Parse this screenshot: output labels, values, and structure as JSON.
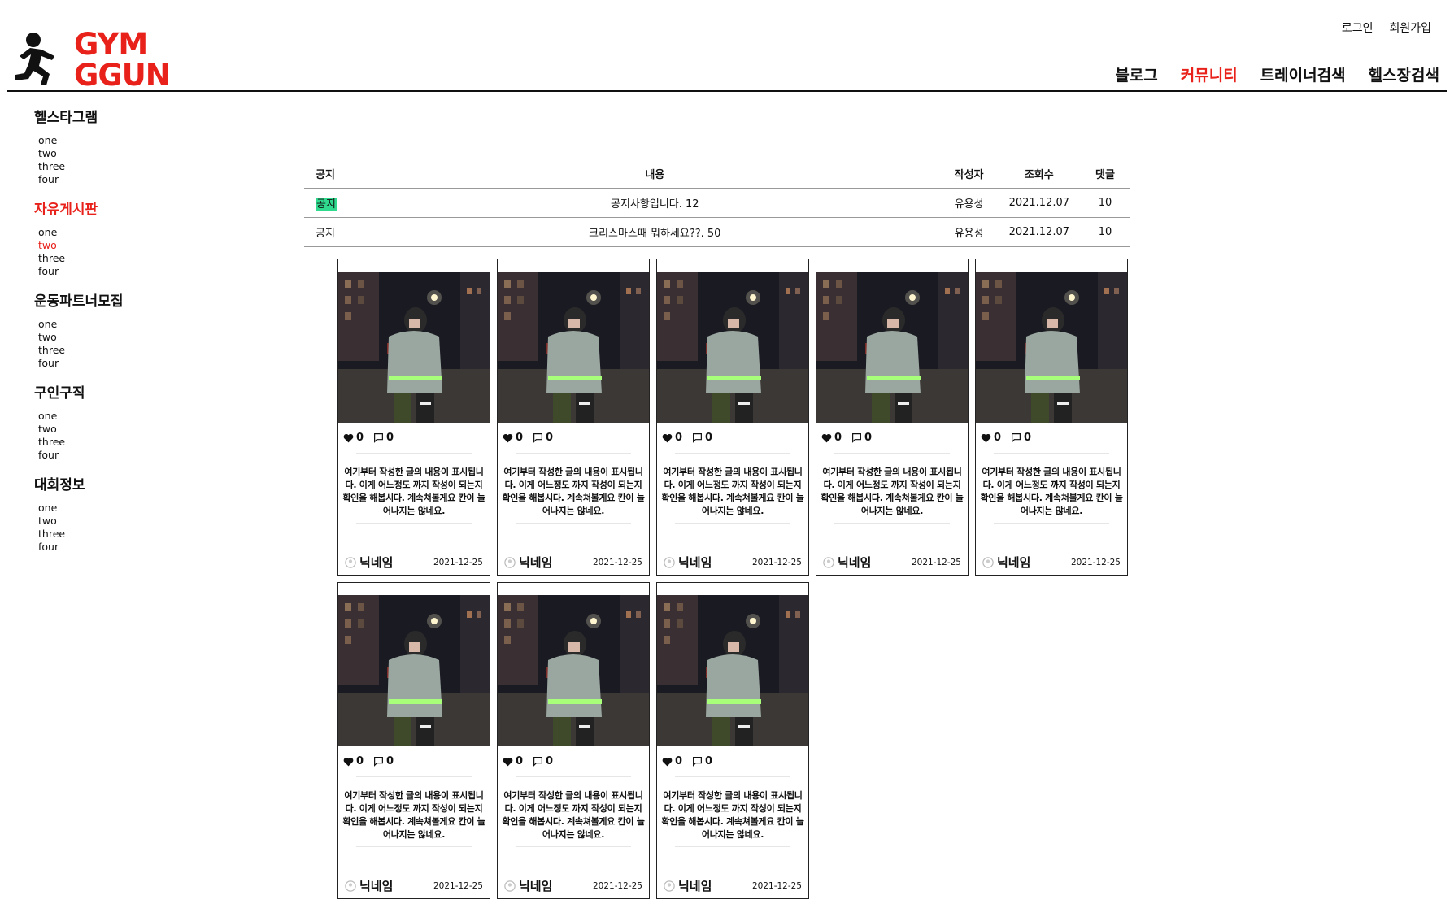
{
  "logo": {
    "line1": "GYM",
    "line2": "GGUN",
    "runner_icon": "runner-icon",
    "brand_color": "#e8211b"
  },
  "auth": {
    "login": "로그인",
    "signup": "회원가입"
  },
  "nav": {
    "items": [
      {
        "label": "블로그"
      },
      {
        "label": "커뮤니티",
        "active": true
      },
      {
        "label": "트레이너검색"
      },
      {
        "label": "헬스장검색"
      }
    ]
  },
  "sidebar": {
    "categories": [
      {
        "title": "헬스타그램",
        "items": [
          "one",
          "two",
          "three",
          "four"
        ]
      },
      {
        "title": "자유게시판",
        "active": true,
        "items": [
          "one",
          "two",
          "three",
          "four"
        ],
        "active_item": "two"
      },
      {
        "title": "운동파트너모집",
        "items": [
          "one",
          "two",
          "three",
          "four"
        ]
      },
      {
        "title": "구인구직",
        "items": [
          "one",
          "two",
          "three",
          "four"
        ]
      },
      {
        "title": "대회정보",
        "items": [
          "one",
          "two",
          "three",
          "four"
        ]
      }
    ]
  },
  "notice_table": {
    "headers": {
      "type": "공지",
      "content": "내용",
      "author": "작성자",
      "views": "조회수",
      "comments": "댓글"
    },
    "rows": [
      {
        "type": "공지",
        "highlighted": true,
        "content": "공지사항입니다. 12",
        "author": "유용성",
        "date": "2021.12.07",
        "comments": "10"
      },
      {
        "type": "공지",
        "highlighted": false,
        "content": "크리스마스때 뭐하세요??. 50",
        "author": "유용성",
        "date": "2021.12.07",
        "comments": "10"
      }
    ],
    "highlight_color": "#2fd98e"
  },
  "posts": [
    {
      "likes": "0",
      "comments": "0",
      "text": "여기부터 작성한 글의 내용이 표시됩니다. 이게 어느정도 까지 작성이 되는지 확인을 해봅시다. 계속쳐볼게요 칸이 늘어나지는 않네요.",
      "author": "닉네임",
      "date": "2021-12-25"
    },
    {
      "likes": "0",
      "comments": "0",
      "text": "여기부터 작성한 글의 내용이 표시됩니다. 이게 어느정도 까지 작성이 되는지 확인을 해봅시다. 계속쳐볼게요 칸이 늘어나지는 않네요.",
      "author": "닉네임",
      "date": "2021-12-25"
    },
    {
      "likes": "0",
      "comments": "0",
      "text": "여기부터 작성한 글의 내용이 표시됩니다. 이게 어느정도 까지 작성이 되는지 확인을 해봅시다. 계속쳐볼게요 칸이 늘어나지는 않네요.",
      "author": "닉네임",
      "date": "2021-12-25"
    },
    {
      "likes": "0",
      "comments": "0",
      "text": "여기부터 작성한 글의 내용이 표시됩니다. 이게 어느정도 까지 작성이 되는지 확인을 해봅시다. 계속쳐볼게요 칸이 늘어나지는 않네요.",
      "author": "닉네임",
      "date": "2021-12-25"
    },
    {
      "likes": "0",
      "comments": "0",
      "text": "여기부터 작성한 글의 내용이 표시됩니다. 이게 어느정도 까지 작성이 되는지 확인을 해봅시다. 계속쳐볼게요 칸이 늘어나지는 않네요.",
      "author": "닉네임",
      "date": "2021-12-25"
    },
    {
      "likes": "0",
      "comments": "0",
      "text": "여기부터 작성한 글의 내용이 표시됩니다. 이게 어느정도 까지 작성이 되는지 확인을 해봅시다. 계속쳐볼게요 칸이 늘어나지는 않네요.",
      "author": "닉네임",
      "date": "2021-12-25"
    },
    {
      "likes": "0",
      "comments": "0",
      "text": "여기부터 작성한 글의 내용이 표시됩니다. 이게 어느정도 까지 작성이 되는지 확인을 해봅시다. 계속쳐볼게요 칸이 늘어나지는 않네요.",
      "author": "닉네임",
      "date": "2021-12-25"
    },
    {
      "likes": "0",
      "comments": "0",
      "text": "여기부터 작성한 글의 내용이 표시됩니다. 이게 어느정도 까지 작성이 되는지 확인을 해봅시다. 계속쳐볼게요 칸이 늘어나지는 않네요.",
      "author": "닉네임",
      "date": "2021-12-25"
    }
  ],
  "icons": {
    "like": "heart-icon",
    "comment": "comment-icon",
    "avatar": "user-avatar-icon"
  }
}
